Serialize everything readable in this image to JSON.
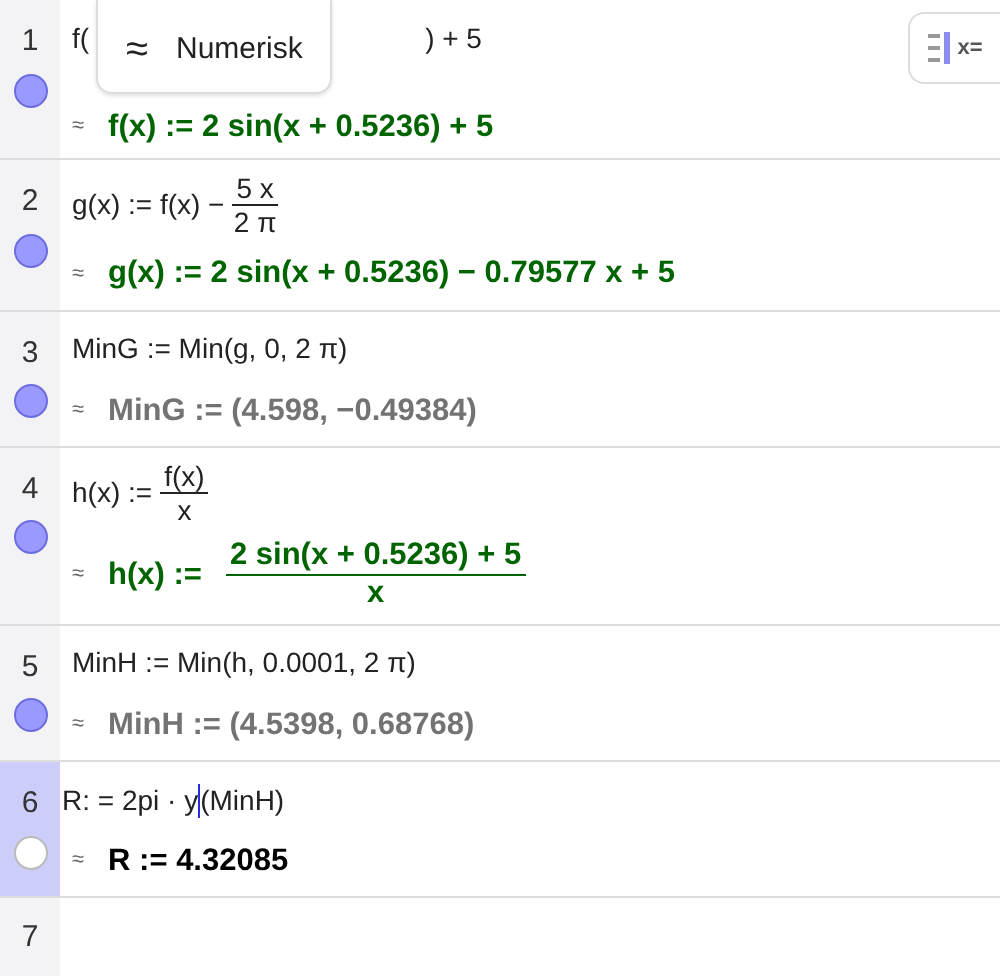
{
  "toggle": {
    "label": "x="
  },
  "tooltip": {
    "symbol": "≈",
    "label": "Numerisk"
  },
  "rows": [
    {
      "number": "1",
      "visible": true,
      "selected": false,
      "input": {
        "kind": "covered",
        "parts": [
          "f(",
          ") + 5"
        ]
      },
      "output": {
        "symbol": "≈",
        "kind": "plain",
        "text": "f(x)  :=  2  sin(x + 0.5236) + 5",
        "color": "#006400"
      }
    },
    {
      "number": "2",
      "visible": true,
      "selected": false,
      "input": {
        "kind": "fraction",
        "lhs": "g(x) := f(x) −",
        "num": "5 x",
        "den": "2 π"
      },
      "output": {
        "symbol": "≈",
        "kind": "plain",
        "text": "g(x)  :=  2  sin(x + 0.5236) − 0.79577 x + 5",
        "color": "#006400"
      }
    },
    {
      "number": "3",
      "visible": true,
      "selected": false,
      "input": {
        "kind": "plain",
        "text": "MinG := Min(g,  0,  2 π)"
      },
      "output": {
        "symbol": "≈",
        "kind": "plain",
        "text": "MinG  :=  (4.598,  −0.49384)",
        "color": "#737373"
      }
    },
    {
      "number": "4",
      "visible": true,
      "selected": false,
      "input": {
        "kind": "fraction",
        "lhs": "h(x) :=",
        "num": "f(x)",
        "den": "x"
      },
      "output": {
        "symbol": "≈",
        "kind": "fraction",
        "lhs": "h(x)  :=",
        "num": "2  sin(x + 0.5236) + 5",
        "den": "x",
        "color": "#006400"
      }
    },
    {
      "number": "5",
      "visible": true,
      "selected": false,
      "input": {
        "kind": "plain",
        "text": "MinH := Min(h,  0.0001,  2 π)"
      },
      "output": {
        "symbol": "≈",
        "kind": "plain",
        "text": "MinH  :=  (4.5398,  0.68768)",
        "color": "#737373"
      }
    },
    {
      "number": "6",
      "visible": false,
      "selected": true,
      "input": {
        "kind": "editing",
        "before": "R: = 2pi · y",
        "after": "(MinH)"
      },
      "output": {
        "symbol": "≈",
        "kind": "plain",
        "text": "R  :=  4.32085",
        "color": "#000000"
      }
    },
    {
      "number": "7",
      "selected": false
    }
  ]
}
